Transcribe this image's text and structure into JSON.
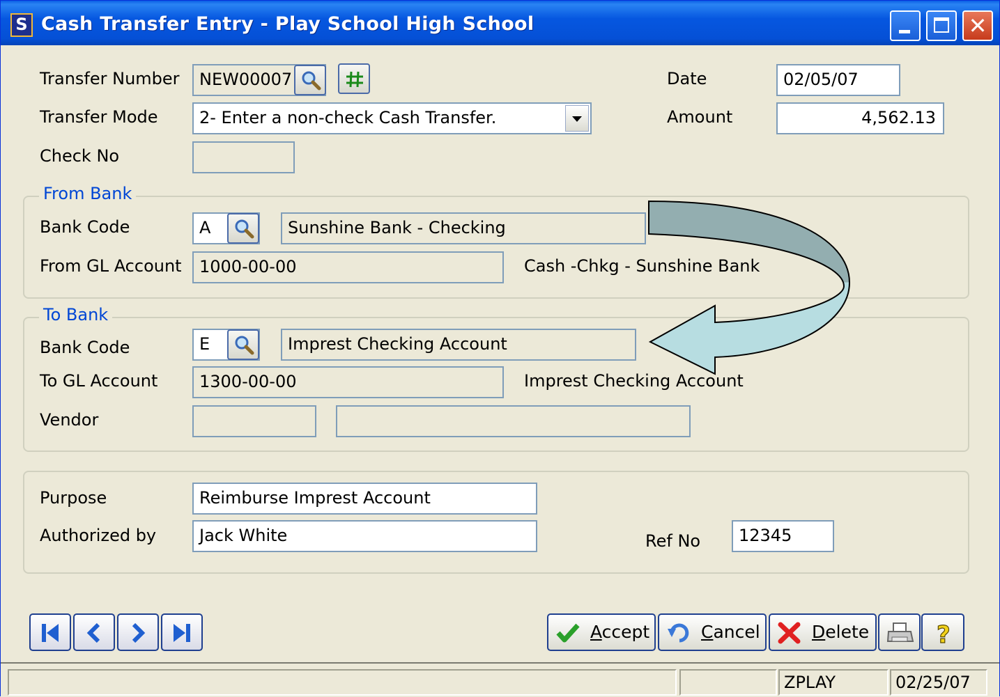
{
  "window": {
    "app_icon_letter": "S",
    "title": "Cash Transfer Entry - Play School High School"
  },
  "header": {
    "transfer_number_label": "Transfer Number",
    "transfer_number_value": "NEW00007",
    "transfer_mode_label": "Transfer Mode",
    "transfer_mode_value": "2- Enter a non-check Cash Transfer.",
    "check_no_label": "Check No",
    "check_no_value": "",
    "date_label": "Date",
    "date_value": "02/05/07",
    "amount_label": "Amount",
    "amount_value": "4,562.13"
  },
  "from_bank": {
    "legend": "From Bank",
    "bank_code_label": "Bank Code",
    "bank_code_value": "A",
    "bank_name": "Sunshine Bank - Checking",
    "gl_label": "From GL Account",
    "gl_value": "1000-00-00",
    "gl_description": "Cash -Chkg - Sunshine Bank"
  },
  "to_bank": {
    "legend": "To Bank",
    "bank_code_label": "Bank Code",
    "bank_code_value": "E",
    "bank_name": "Imprest Checking Account",
    "gl_label": "To GL Account",
    "gl_value": "1300-00-00",
    "gl_description": "Imprest Checking Account",
    "vendor_label": "Vendor",
    "vendor_code": "",
    "vendor_name": ""
  },
  "details": {
    "purpose_label": "Purpose",
    "purpose_value": "Reimburse Imprest Account",
    "authorized_label": "Authorized by",
    "authorized_value": "Jack White",
    "ref_label": "Ref No",
    "ref_value": "12345"
  },
  "buttons": {
    "accept_hotkey": "A",
    "accept_rest": "ccept",
    "cancel_hotkey": "C",
    "cancel_rest": "ancel",
    "delete_hotkey": "D",
    "delete_rest": "elete"
  },
  "statusbar": {
    "cell1": "",
    "cell2": "",
    "user": "ZPLAY",
    "date": "02/25/07"
  },
  "colors": {
    "titlebar": "#0a5fe6",
    "window_bg": "#ece9d8",
    "group_legend": "#0046d5",
    "arrow_top": "#93aeb0",
    "arrow_bottom": "#b7dde1"
  },
  "icons": {
    "lookup": "magnifier-icon",
    "next_number": "hash-icon",
    "nav_first": "first-record-icon",
    "nav_prev": "previous-record-icon",
    "nav_next": "next-record-icon",
    "nav_last": "last-record-icon",
    "accept": "checkmark-icon",
    "cancel": "undo-icon",
    "delete": "red-x-icon",
    "print": "printer-icon",
    "help": "help-question-icon"
  }
}
